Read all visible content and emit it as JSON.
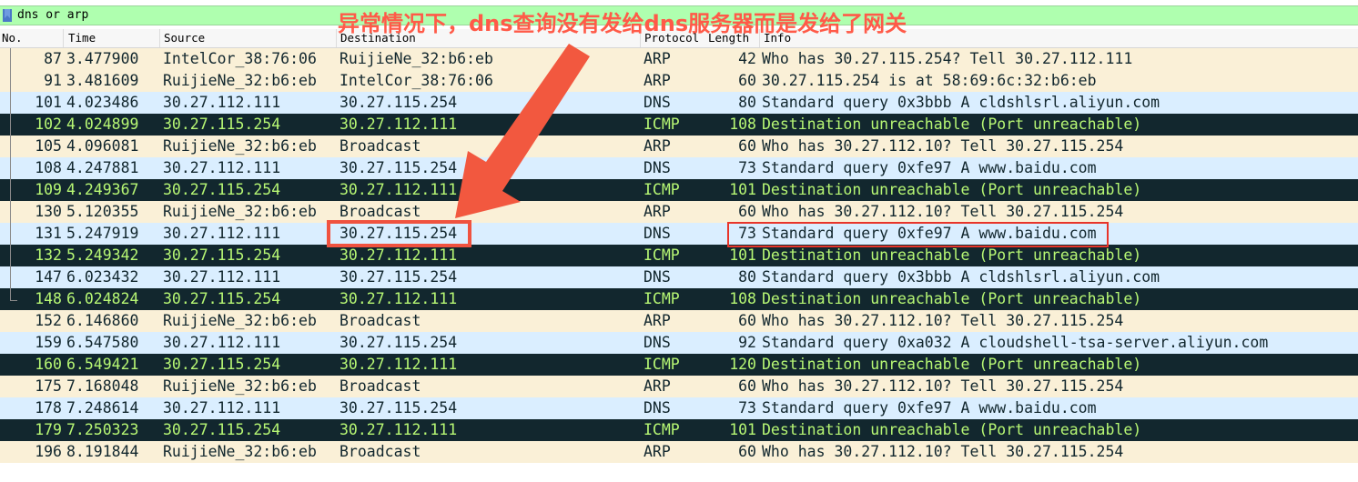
{
  "filter": {
    "text": "dns or arp",
    "bar_color": "#afffaf"
  },
  "header": {
    "no": "No.",
    "time": "Time",
    "source": "Source",
    "destination": "Destination",
    "protocol": "Protocol",
    "length": "Length",
    "info": "Info"
  },
  "annotation": {
    "text": "异常情况下，dns查询没有发给dns服务器而是发给了网关",
    "color": "#ff5a48"
  },
  "colors": {
    "arp_bg": "#faf0d7",
    "dns_bg": "#daeeff",
    "icmp_bg": "#12272e",
    "icmp_fg": "#b7f774",
    "highlight": "#f0523f"
  },
  "packets": [
    {
      "no": "87",
      "time": "3.477900",
      "source": "IntelCor_38:76:06",
      "destination": "RuijieNe_32:b6:eb",
      "protocol": "ARP",
      "length": "42",
      "info": "Who has 30.27.115.254? Tell 30.27.112.111",
      "kind": "arp"
    },
    {
      "no": "91",
      "time": "3.481609",
      "source": "RuijieNe_32:b6:eb",
      "destination": "IntelCor_38:76:06",
      "protocol": "ARP",
      "length": "60",
      "info": "30.27.115.254 is at 58:69:6c:32:b6:eb",
      "kind": "arp"
    },
    {
      "no": "101",
      "time": "4.023486",
      "source": "30.27.112.111",
      "destination": "30.27.115.254",
      "protocol": "DNS",
      "length": "80",
      "info": "Standard query 0x3bbb A cldshlsrl.aliyun.com",
      "kind": "dns"
    },
    {
      "no": "102",
      "time": "4.024899",
      "source": "30.27.115.254",
      "destination": "30.27.112.111",
      "protocol": "ICMP",
      "length": "108",
      "info": "Destination unreachable (Port unreachable)",
      "kind": "icmp"
    },
    {
      "no": "105",
      "time": "4.096081",
      "source": "RuijieNe_32:b6:eb",
      "destination": "Broadcast",
      "protocol": "ARP",
      "length": "60",
      "info": "Who has 30.27.112.10? Tell 30.27.115.254",
      "kind": "arp"
    },
    {
      "no": "108",
      "time": "4.247881",
      "source": "30.27.112.111",
      "destination": "30.27.115.254",
      "protocol": "DNS",
      "length": "73",
      "info": "Standard query 0xfe97 A www.baidu.com",
      "kind": "dns"
    },
    {
      "no": "109",
      "time": "4.249367",
      "source": "30.27.115.254",
      "destination": "30.27.112.111",
      "protocol": "ICMP",
      "length": "101",
      "info": "Destination unreachable (Port unreachable)",
      "kind": "icmp"
    },
    {
      "no": "130",
      "time": "5.120355",
      "source": "RuijieNe_32:b6:eb",
      "destination": "Broadcast",
      "protocol": "ARP",
      "length": "60",
      "info": "Who has 30.27.112.10? Tell 30.27.115.254",
      "kind": "arp"
    },
    {
      "no": "131",
      "time": "5.247919",
      "source": "30.27.112.111",
      "destination": "30.27.115.254",
      "protocol": "DNS",
      "length": "73",
      "info": "Standard query 0xfe97 A www.baidu.com",
      "kind": "dns"
    },
    {
      "no": "132",
      "time": "5.249342",
      "source": "30.27.115.254",
      "destination": "30.27.112.111",
      "protocol": "ICMP",
      "length": "101",
      "info": "Destination unreachable (Port unreachable)",
      "kind": "icmp"
    },
    {
      "no": "147",
      "time": "6.023432",
      "source": "30.27.112.111",
      "destination": "30.27.115.254",
      "protocol": "DNS",
      "length": "80",
      "info": "Standard query 0x3bbb A cldshlsrl.aliyun.com",
      "kind": "dns"
    },
    {
      "no": "148",
      "time": "6.024824",
      "source": "30.27.115.254",
      "destination": "30.27.112.111",
      "protocol": "ICMP",
      "length": "108",
      "info": "Destination unreachable (Port unreachable)",
      "kind": "icmp"
    },
    {
      "no": "152",
      "time": "6.146860",
      "source": "RuijieNe_32:b6:eb",
      "destination": "Broadcast",
      "protocol": "ARP",
      "length": "60",
      "info": "Who has 30.27.112.10? Tell 30.27.115.254",
      "kind": "arp"
    },
    {
      "no": "159",
      "time": "6.547580",
      "source": "30.27.112.111",
      "destination": "30.27.115.254",
      "protocol": "DNS",
      "length": "92",
      "info": "Standard query 0xa032 A cloudshell-tsa-server.aliyun.com",
      "kind": "dns"
    },
    {
      "no": "160",
      "time": "6.549421",
      "source": "30.27.115.254",
      "destination": "30.27.112.111",
      "protocol": "ICMP",
      "length": "120",
      "info": "Destination unreachable (Port unreachable)",
      "kind": "icmp"
    },
    {
      "no": "175",
      "time": "7.168048",
      "source": "RuijieNe_32:b6:eb",
      "destination": "Broadcast",
      "protocol": "ARP",
      "length": "60",
      "info": "Who has 30.27.112.10? Tell 30.27.115.254",
      "kind": "arp"
    },
    {
      "no": "178",
      "time": "7.248614",
      "source": "30.27.112.111",
      "destination": "30.27.115.254",
      "protocol": "DNS",
      "length": "73",
      "info": "Standard query 0xfe97 A www.baidu.com",
      "kind": "dns"
    },
    {
      "no": "179",
      "time": "7.250323",
      "source": "30.27.115.254",
      "destination": "30.27.112.111",
      "protocol": "ICMP",
      "length": "101",
      "info": "Destination unreachable (Port unreachable)",
      "kind": "icmp"
    },
    {
      "no": "196",
      "time": "8.191844",
      "source": "RuijieNe_32:b6:eb",
      "destination": "Broadcast",
      "protocol": "ARP",
      "length": "60",
      "info": "Who has 30.27.112.10? Tell 30.27.115.254",
      "kind": "arp"
    }
  ]
}
